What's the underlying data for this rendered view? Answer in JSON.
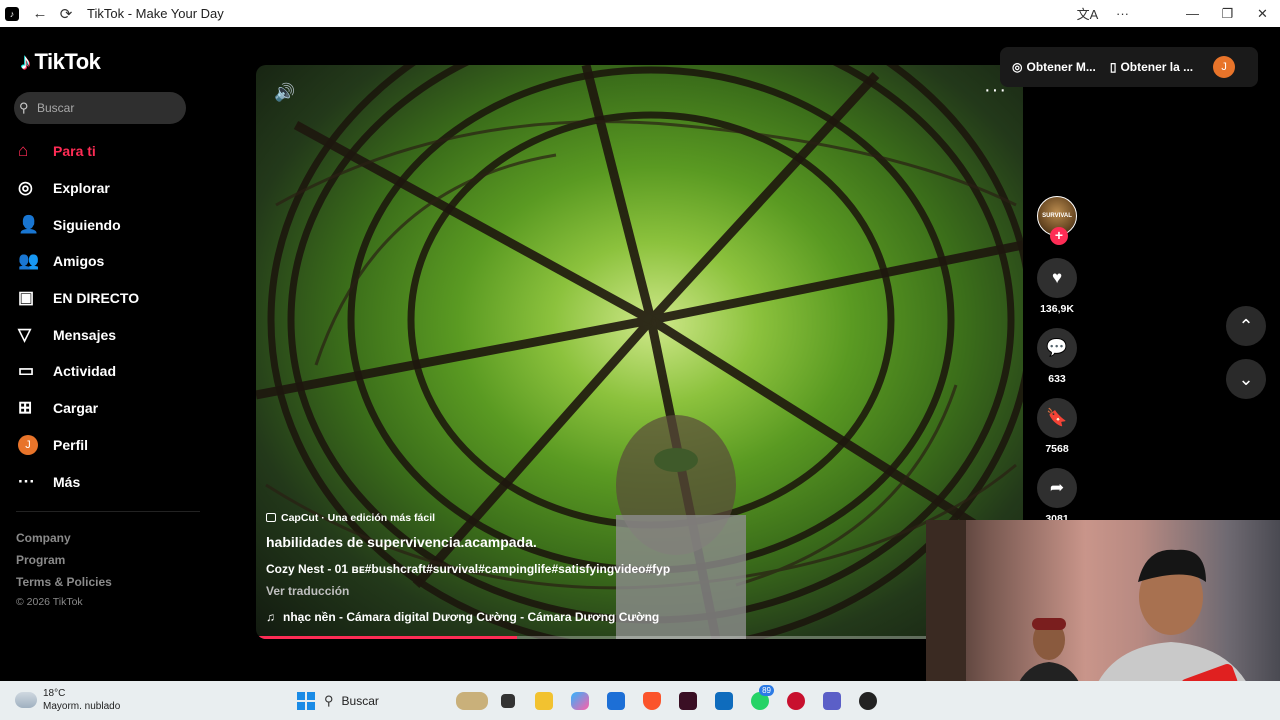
{
  "browser": {
    "title": "TikTok - Make Your Day",
    "back_icon": "←",
    "reload_icon": "⟳",
    "translate_icon": "文A",
    "more_icon": "···",
    "minimize_icon": "—",
    "maximize_icon": "❐",
    "close_icon": "✕"
  },
  "sidebar": {
    "logo": "TikTok",
    "search_placeholder": "Buscar",
    "items": [
      {
        "label": "Para ti",
        "icon": "home-icon",
        "glyph": "⌂"
      },
      {
        "label": "Explorar",
        "icon": "compass-icon",
        "glyph": "◎"
      },
      {
        "label": "Siguiendo",
        "icon": "following-icon",
        "glyph": "👤"
      },
      {
        "label": "Amigos",
        "icon": "friends-icon",
        "glyph": "👥"
      },
      {
        "label": "EN DIRECTO",
        "icon": "live-icon",
        "glyph": "▣"
      },
      {
        "label": "Mensajes",
        "icon": "messages-icon",
        "glyph": "▽"
      },
      {
        "label": "Actividad",
        "icon": "activity-icon",
        "glyph": "▭"
      },
      {
        "label": "Cargar",
        "icon": "upload-icon",
        "glyph": "⊞"
      },
      {
        "label": "Perfil",
        "icon": "profile-avatar",
        "glyph": "J"
      },
      {
        "label": "Más",
        "icon": "more-icon",
        "glyph": "···"
      }
    ],
    "footer": [
      "Company",
      "Program",
      "Terms & Policies"
    ],
    "copyright": "© 2026 TikTok"
  },
  "video": {
    "capcut": "CapCut · Una edición más fácil",
    "title": "habilidades de supervivencia.acampada.",
    "tags": "Cozy Nest - 01 ʙᴇ#bushcraft#survival#campinglife#satisfyingvideo#fyp",
    "translate": "Ver traducción",
    "music": "nhạc nền - Cámara digital Dương Cường - Cámara Dương Cường",
    "progress": 0.34
  },
  "actions": {
    "creator_avatar_text": "SURVIVAL",
    "likes": "136,9K",
    "comments": "633",
    "saves": "7568",
    "shares": "3081"
  },
  "topbar": {
    "coins": "Obtener M...",
    "app": "Obtener la ...",
    "avatar": "J"
  },
  "taskbar": {
    "temp": "18°C",
    "condition": "Mayorm. nublado",
    "search": "Buscar",
    "whatsapp_badge": "89"
  },
  "colors": {
    "accent": "#fe2c55",
    "sidebar_bg": "#000000",
    "taskbar_bg": "#e9eef0"
  }
}
